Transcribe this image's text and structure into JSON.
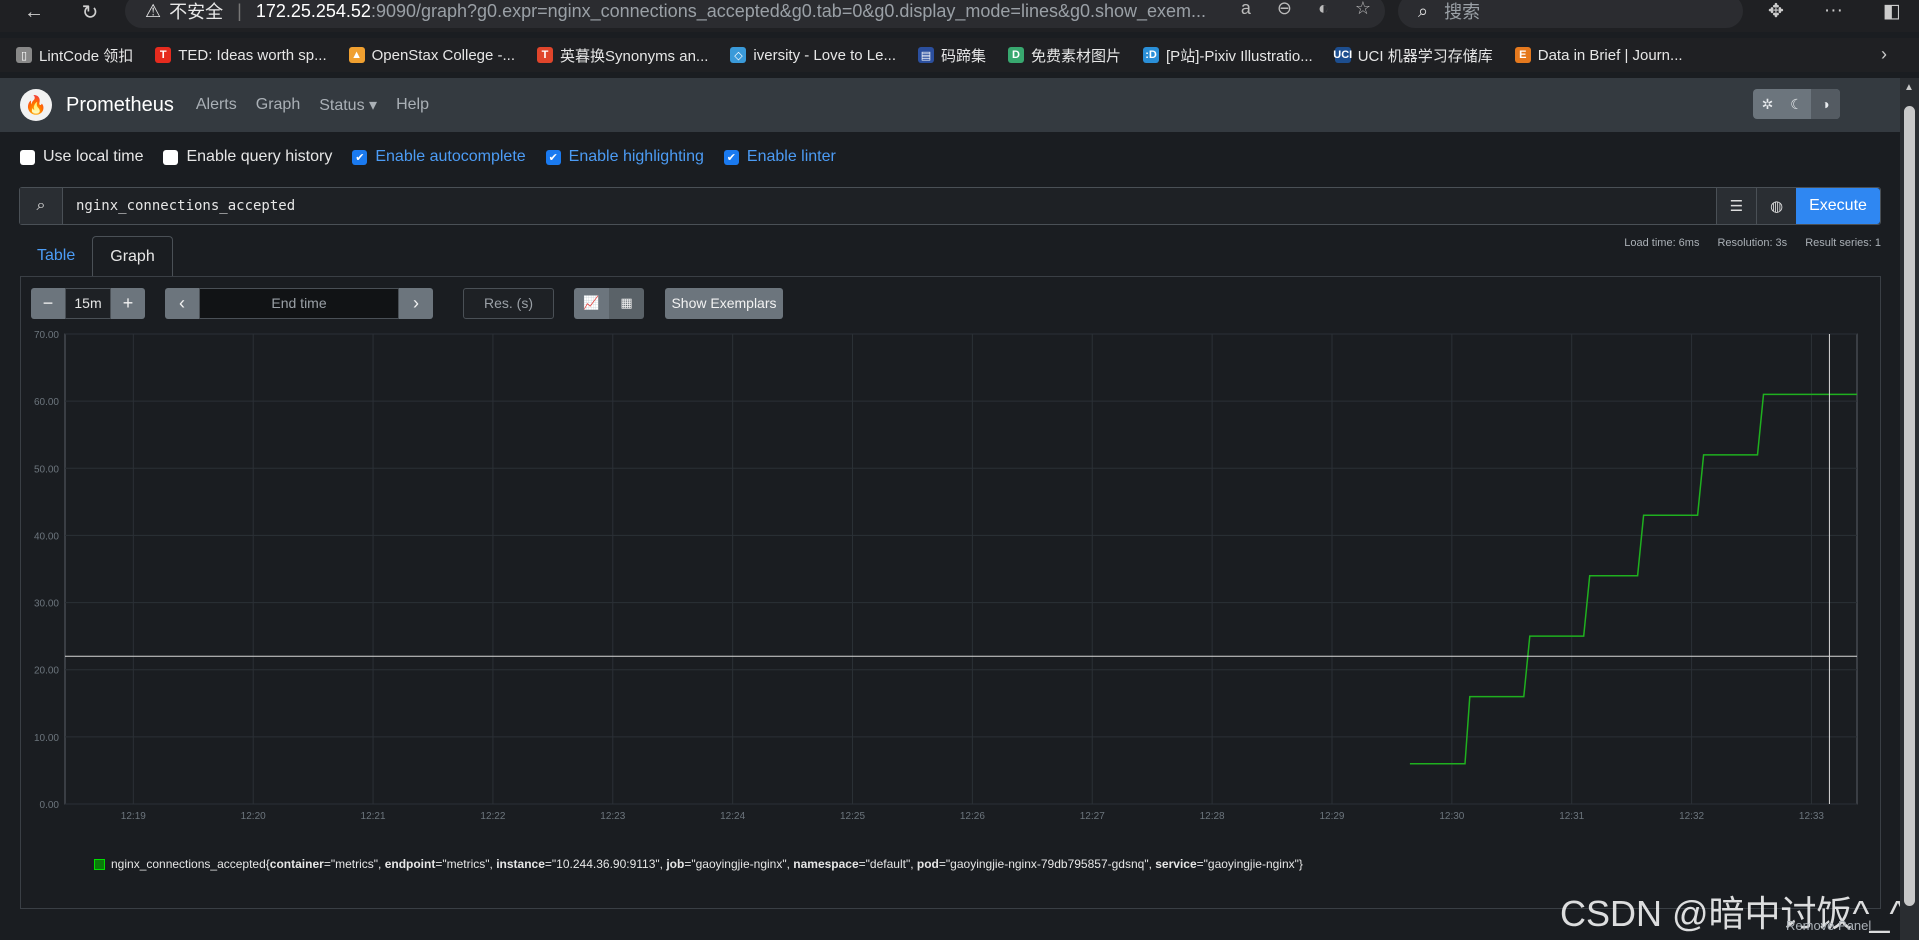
{
  "browser": {
    "insecure_label": "不安全",
    "url_host": "172.25.254.52",
    "url_rest": ":9090/graph?g0.expr=nginx_connections_accepted&g0.tab=0&g0.display_mode=lines&g0.show_exem...",
    "search_placeholder": "搜索"
  },
  "bookmarks": [
    {
      "label": "LintCode 领扣",
      "color": "#888888",
      "glyph": "▯"
    },
    {
      "label": "TED: Ideas worth sp...",
      "color": "#e62b1e",
      "glyph": "T"
    },
    {
      "label": "OpenStax College -...",
      "color": "#f0a030",
      "glyph": "▲"
    },
    {
      "label": "英暮换Synonyms an...",
      "color": "#e0452b",
      "glyph": "T"
    },
    {
      "label": "iversity - Love to Le...",
      "color": "#3a9ad9",
      "glyph": "◇"
    },
    {
      "label": "码蹄集",
      "color": "#2b4f9e",
      "glyph": "▤"
    },
    {
      "label": "免费素材图片",
      "color": "#38a86f",
      "glyph": "D"
    },
    {
      "label": "[P站]-Pixiv Illustratio...",
      "color": "#2a8fd8",
      "glyph": ":D"
    },
    {
      "label": "UCI 机器学习存储库",
      "color": "#1d4e8f",
      "glyph": "UCI"
    },
    {
      "label": "Data in Brief | Journ...",
      "color": "#e5791e",
      "glyph": "E"
    }
  ],
  "nav": {
    "brand": "Prometheus",
    "links": [
      "Alerts",
      "Graph",
      "Status ▾",
      "Help"
    ]
  },
  "options": [
    {
      "label": "Use local time",
      "checked": false
    },
    {
      "label": "Enable query history",
      "checked": false
    },
    {
      "label": "Enable autocomplete",
      "checked": true
    },
    {
      "label": "Enable highlighting",
      "checked": true
    },
    {
      "label": "Enable linter",
      "checked": true
    }
  ],
  "query": {
    "expression": "nginx_connections_accepted",
    "execute_label": "Execute"
  },
  "stats": {
    "load_time": "Load time: 6ms",
    "resolution": "Resolution: 3s",
    "result_series": "Result series: 1"
  },
  "tabs": [
    {
      "label": "Table",
      "active": false
    },
    {
      "label": "Graph",
      "active": true
    }
  ],
  "controls": {
    "range": "15m",
    "end_time_placeholder": "End time",
    "resolution_placeholder": "Res. (s)",
    "exemplars_label": "Show Exemplars"
  },
  "chart_data": {
    "type": "line",
    "x_ticks": [
      "12:19",
      "12:20",
      "12:21",
      "12:22",
      "12:23",
      "12:24",
      "12:25",
      "12:26",
      "12:27",
      "12:28",
      "12:29",
      "12:30",
      "12:31",
      "12:32",
      "12:33"
    ],
    "y_ticks": [
      "0.00",
      "10.00",
      "20.00",
      "30.00",
      "40.00",
      "50.00",
      "60.00",
      "70.00"
    ],
    "ylim": [
      0,
      70
    ],
    "xlim_minutes": [
      0,
      14.95
    ],
    "grid": true,
    "series": [
      {
        "name": "nginx_connections_accepted",
        "color": "#1fb01f",
        "points": [
          [
            11.22,
            6
          ],
          [
            11.68,
            6
          ],
          [
            11.72,
            16
          ],
          [
            12.17,
            16
          ],
          [
            12.22,
            25
          ],
          [
            12.67,
            25
          ],
          [
            12.72,
            34
          ],
          [
            13.12,
            34
          ],
          [
            13.17,
            43
          ],
          [
            13.62,
            43
          ],
          [
            13.67,
            52
          ],
          [
            14.12,
            52
          ],
          [
            14.17,
            61
          ],
          [
            14.95,
            61
          ]
        ]
      }
    ],
    "cursor": {
      "x_minutes": 14.72,
      "y": 22
    }
  },
  "legend": {
    "metric": "nginx_connections_accepted{",
    "labels": [
      {
        "key": "container",
        "value": "\"metrics\""
      },
      {
        "key": "endpoint",
        "value": "\"metrics\""
      },
      {
        "key": "instance",
        "value": "\"10.244.36.90:9113\""
      },
      {
        "key": "job",
        "value": "\"gaoyingjie-nginx\""
      },
      {
        "key": "namespace",
        "value": "\"default\""
      },
      {
        "key": "pod",
        "value": "\"gaoyingjie-nginx-79db795857-gdsnq\""
      },
      {
        "key": "service",
        "value": "\"gaoyingjie-nginx\""
      }
    ]
  },
  "remove_panel": "Remove Panel",
  "watermark": "CSDN @暗中讨饭^_^"
}
